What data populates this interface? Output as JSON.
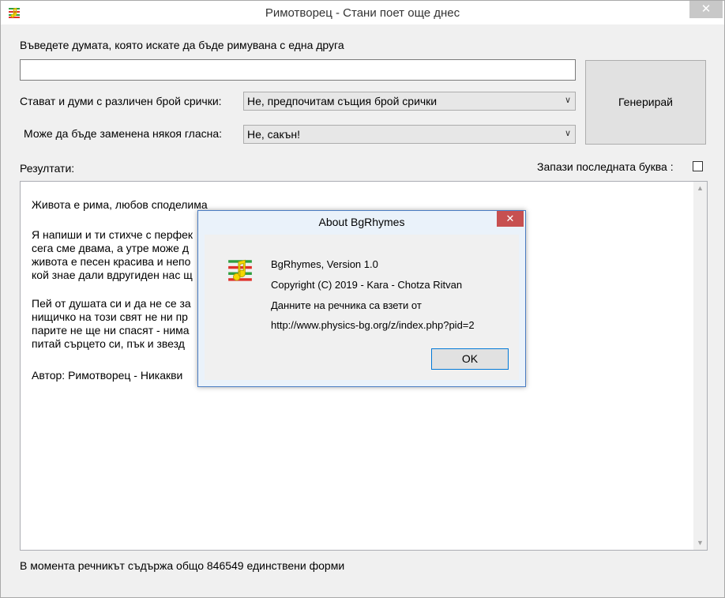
{
  "window": {
    "title": "Римотворец - Стани поет още днес",
    "close_glyph": "✕"
  },
  "form": {
    "word_prompt": "Въведете думата, която искате да бъде римувана с една друга",
    "word_value": "",
    "syllables_label": "Стават и думи с различен брой срички:",
    "syllables_value": "Не, предпочитам същия брой срички",
    "vowel_label": "Може да бъде заменена някоя гласна:",
    "vowel_value": "Не, сакън!",
    "generate_label": "Генерирай",
    "results_label": "Резултати:",
    "keep_last_label": "Запази последната буква :"
  },
  "results": {
    "lines": [
      "Живота е рима, любов споделима",
      "Я напиши и ти стихче с перфек",
      "сега сме двама, а утре може д",
      "живота е песен красива и непо",
      "кой знае дали вдругиден нас щ",
      "Пей от душата си и да не се за",
      "нищичко на този свят не ни пр",
      "парите не ще ни спасят - нима",
      "питай сърцето си, пък и звезд",
      "Автор: Римотворец - Никакви"
    ]
  },
  "status": {
    "text": "В момента речникът съдържа общо 846549 единствени форми"
  },
  "dialog": {
    "title": "About BgRhymes",
    "close_glyph": "✕",
    "version": "BgRhymes, Version 1.0",
    "copyright": "Copyright (C) 2019 - Kara - Chotza Ritvan",
    "source_note": "Данните на речника са взети от",
    "url": "http://www.physics-bg.org/z/index.php?pid=2",
    "ok_label": "OK"
  },
  "icons": {
    "app": "rhyme-notes-icon",
    "dropdown": "chevron-down-icon"
  },
  "colors": {
    "dialog_border": "#4a7cc2",
    "dialog_close": "#c75050",
    "ok_focus": "#0078d7"
  }
}
